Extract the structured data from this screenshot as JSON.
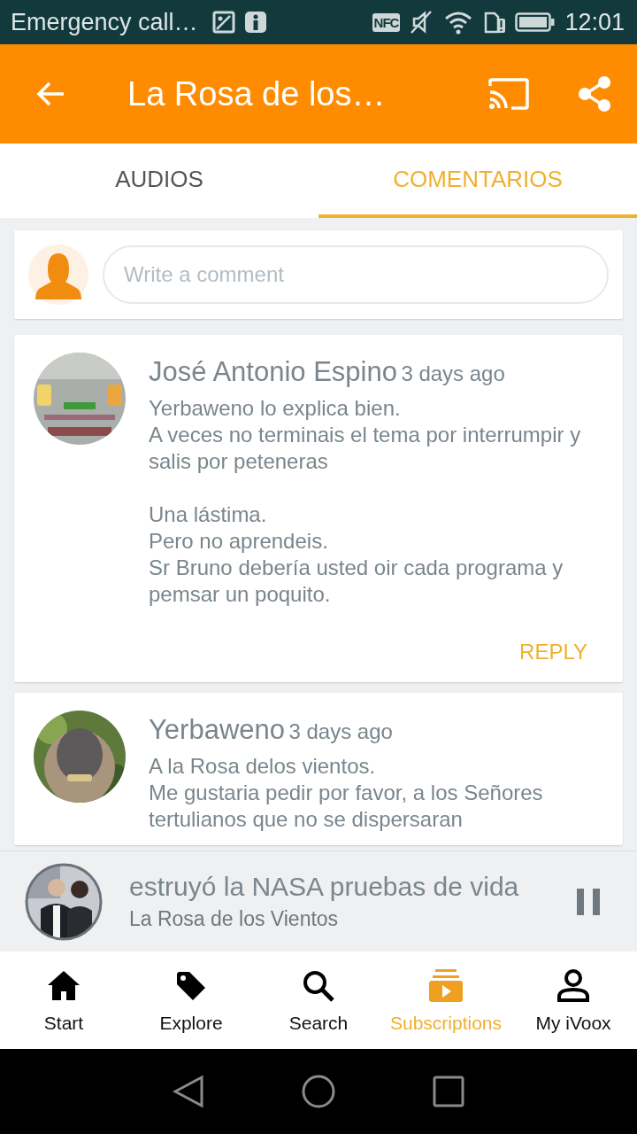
{
  "status_bar": {
    "notification": "Emergency call…",
    "nfc": "NFC",
    "time": "12:01"
  },
  "app_bar": {
    "title": "La Rosa de los…"
  },
  "tabs": [
    {
      "label": "AUDIOS",
      "selected": false
    },
    {
      "label": "COMENTARIOS",
      "selected": true
    }
  ],
  "comment_box": {
    "placeholder": "Write a comment"
  },
  "comments": [
    {
      "author": "José Antonio Espino",
      "time": "3 days ago",
      "paragraphs": [
        [
          "Yerbaweno lo explica bien.",
          "A veces no terminais el tema por interrumpir y salis por peteneras"
        ],
        [
          "Una lástima.",
          "Pero no aprendeis.",
          "Sr Bruno debería usted oir cada programa y pemsar un poquito."
        ]
      ],
      "reply": "REPLY"
    },
    {
      "author": "Yerbaweno",
      "time": "3 days ago",
      "paragraphs": [
        [
          "A la Rosa delos vientos.",
          "Me gustaria pedir por favor, a los Señores",
          "tertulianos que no se dispersaran"
        ]
      ]
    }
  ],
  "player": {
    "episode": "estruyó la NASA pruebas de vida",
    "program": "La Rosa de los Vientos",
    "playing": true
  },
  "bottom_nav": [
    {
      "kind": "home",
      "label": "Start",
      "selected": false
    },
    {
      "kind": "tag",
      "label": "Explore",
      "selected": false
    },
    {
      "kind": "search",
      "label": "Search",
      "selected": false
    },
    {
      "kind": "subscriptions",
      "label": "Subscriptions",
      "selected": true
    },
    {
      "kind": "person",
      "label": "My iVoox",
      "selected": false
    }
  ]
}
